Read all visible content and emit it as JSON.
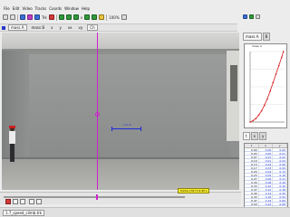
{
  "menu": [
    "File",
    "Edit",
    "Video",
    "Tracks",
    "Coords",
    "Window",
    "Help"
  ],
  "toolbar": {
    "track_label": "Trk",
    "vector_label": "v",
    "zoom_label": "100%"
  },
  "trackbar": {
    "items": [
      "mass A",
      "mass B",
      "x",
      "y",
      "vx",
      "vy",
      "t"
    ],
    "active_track": "mass A",
    "selected_label": "Ch"
  },
  "video": {
    "stick_label": "1.0 m"
  },
  "player": {
    "frame_readout": "frame 132  t=4.40 s"
  },
  "statusbar": {
    "tab_label": "1.7_speed_climb.trk"
  },
  "right_panel": {
    "tabs": [
      "mass A",
      "B"
    ],
    "plot_title": "mass A",
    "table_tabs": [
      "t",
      "x",
      "y"
    ],
    "table_columns": [
      "t",
      "x",
      "y"
    ],
    "table_rows": [
      [
        "0.00",
        "0.00",
        "0.00"
      ],
      [
        "0.03",
        "0.00",
        "0.01"
      ],
      [
        "0.07",
        "0.01",
        "0.02"
      ],
      [
        "0.10",
        "0.01",
        "0.04"
      ],
      [
        "0.13",
        "0.02",
        "0.06"
      ],
      [
        "0.17",
        "0.03",
        "0.09"
      ],
      [
        "0.20",
        "0.04",
        "0.12"
      ],
      [
        "0.23",
        "0.05",
        "0.16"
      ],
      [
        "0.27",
        "0.06",
        "0.21"
      ],
      [
        "0.30",
        "0.08",
        "0.26"
      ],
      [
        "0.33",
        "0.10",
        "0.32"
      ],
      [
        "0.37",
        "0.12",
        "0.38"
      ],
      [
        "0.40",
        "0.14",
        "0.45"
      ],
      [
        "0.43",
        "0.16",
        "0.52"
      ],
      [
        "0.47",
        "0.19",
        "0.60"
      ],
      [
        "0.50",
        "0.22",
        "0.68"
      ],
      [
        "0.53",
        "0.25",
        "0.77"
      ],
      [
        "0.57",
        "0.28",
        "0.86"
      ],
      [
        "0.60",
        "0.32",
        "0.96"
      ]
    ]
  },
  "plot_points": [
    [
      0.0,
      0.0
    ],
    [
      0.05,
      0.02
    ],
    [
      0.1,
      0.05
    ],
    [
      0.15,
      0.1
    ],
    [
      0.2,
      0.16
    ],
    [
      0.25,
      0.24
    ],
    [
      0.3,
      0.33
    ],
    [
      0.35,
      0.44
    ],
    [
      0.4,
      0.56
    ],
    [
      0.45,
      0.68
    ],
    [
      0.5,
      0.8
    ],
    [
      0.55,
      0.92
    ],
    [
      0.58,
      1.0
    ]
  ],
  "plot_ranges": {
    "x": [
      0,
      0.6
    ],
    "y": [
      0,
      1.0
    ]
  },
  "colors": {
    "track": "#d01fd0",
    "calibration": "#1d2bd8",
    "plot_line": "#d41a1a",
    "readout_bg": "#f5ea2a"
  }
}
